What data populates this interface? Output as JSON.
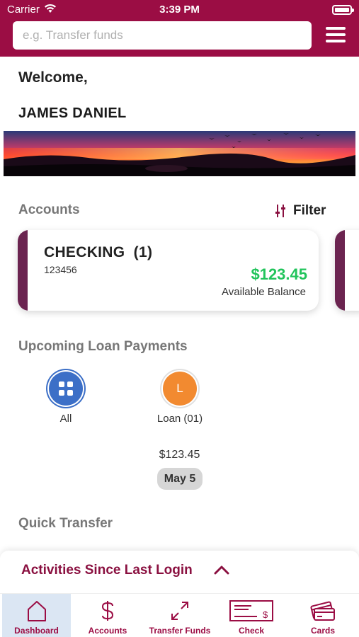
{
  "status_bar": {
    "carrier": "Carrier",
    "time": "3:39 PM"
  },
  "header": {
    "search_placeholder": "e.g. Transfer funds",
    "background_color": "#9b0d44"
  },
  "welcome": {
    "greeting": "Welcome,",
    "name": "JAMES DANIEL"
  },
  "accounts_section": {
    "title": "Accounts",
    "filter_label": "Filter",
    "cards": [
      {
        "name": "CHECKING  (1)",
        "number": "123456",
        "balance": "$123.45",
        "balance_label": "Available Balance",
        "stripe_color": "#6b2450"
      }
    ]
  },
  "upcoming_loans": {
    "title": "Upcoming Loan Payments",
    "items": [
      {
        "label": "All",
        "icon": "grid-icon",
        "color": "#3c6fc7"
      },
      {
        "label": "Loan (01)",
        "initial": "L",
        "color": "#f28a30"
      }
    ],
    "amount": "$123.45",
    "date": "May 5"
  },
  "quick_transfer": {
    "title": "Quick Transfer"
  },
  "activities": {
    "title": "Activities Since Last Login",
    "icon": "chevron-up-icon"
  },
  "tabbar": {
    "tabs": [
      {
        "label": "Dashboard",
        "icon": "home-icon",
        "active": true
      },
      {
        "label": "Accounts",
        "icon": "dollar-icon",
        "active": false
      },
      {
        "label": "Transfer Funds",
        "icon": "transfer-arrows-icon",
        "active": false
      },
      {
        "label": "Check",
        "icon": "check-icon",
        "active": false
      },
      {
        "label": "Cards",
        "icon": "cards-icon",
        "active": false
      }
    ],
    "accent_color": "#9b0d44",
    "active_bg": "#dbe6f3"
  }
}
